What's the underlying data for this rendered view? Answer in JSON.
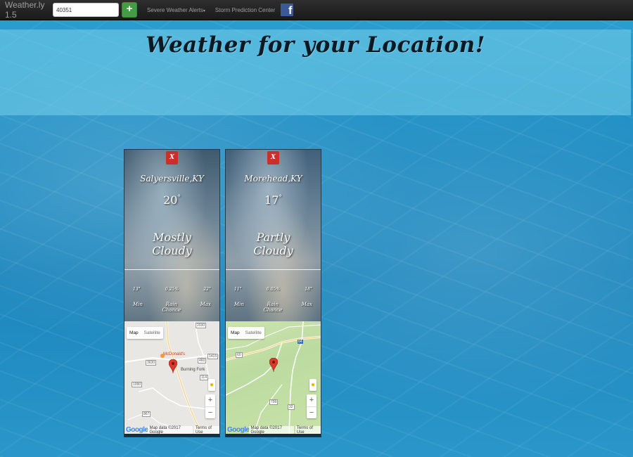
{
  "navbar": {
    "brand": "Weather.ly 1.5",
    "zip_value": "40351",
    "add_label": "+",
    "links": [
      {
        "label": "Severe Weather Alerts",
        "caret": "▾"
      },
      {
        "label": "Storm Prediction Center"
      }
    ],
    "facebook_icon": "facebook-icon"
  },
  "hero": {
    "title": "Weather for your Location!"
  },
  "cards": [
    {
      "close_label": "X",
      "city": "Salyersville,KY",
      "temp": "20",
      "degree": "°",
      "condition_line1": "Mostly",
      "condition_line2": "Cloudy",
      "min_value": "13°",
      "rain_value": "0.25%",
      "max_value": "22°",
      "min_label": "Min",
      "rain_label_line1": "Rain",
      "rain_label_line2": "Chance",
      "max_label": "Max",
      "map": {
        "type_map": "Map",
        "type_satellite": "Satellite",
        "place_label": "McDonald's",
        "town_label": "Burning Fork",
        "route_labels": [
          "2030",
          "1415",
          "460",
          "3630",
          "114",
          "1090",
          "867"
        ],
        "zoom_in": "+",
        "zoom_out": "−",
        "logo": "Google",
        "attribution": "Map data ©2017 Google",
        "terms": "Terms of Use"
      }
    },
    {
      "close_label": "X",
      "city": "Morehead,KY",
      "temp": "17",
      "degree": "°",
      "condition_line1": "Partly",
      "condition_line2": "Cloudy",
      "min_value": "11°",
      "rain_value": "0.05%",
      "max_value": "18°",
      "min_label": "Min",
      "rain_label_line1": "Rain",
      "rain_label_line2": "Chance",
      "max_label": "Max",
      "map": {
        "type_map": "Map",
        "type_satellite": "Satellite",
        "route_labels": [
          "64",
          "60",
          "32",
          "799"
        ],
        "zoom_in": "+",
        "zoom_out": "−",
        "logo": "Google",
        "attribution": "Map data ©2017 Google",
        "terms": "Terms of Use"
      }
    }
  ],
  "colors": {
    "navbar": "#222222",
    "add_button": "#449d44",
    "close_button": "#c9302c",
    "facebook": "#3b5998",
    "map_pin": "#d93a2b"
  }
}
